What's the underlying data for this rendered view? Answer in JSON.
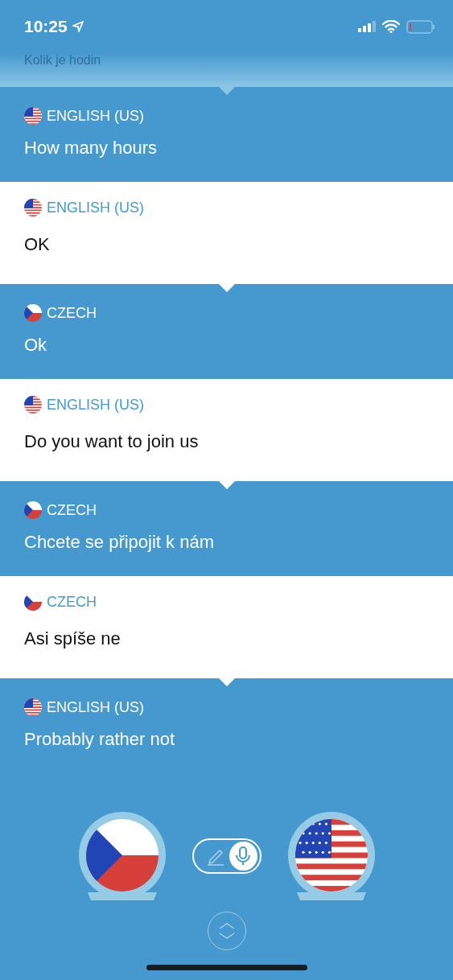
{
  "status_bar": {
    "time": "10:25"
  },
  "faded_message": {
    "text": "Kolik je hodin"
  },
  "messages": [
    {
      "kind": "translation",
      "flag": {
        "kind": "us"
      },
      "language": "ENGLISH (US)",
      "text": "How many hours"
    },
    {
      "kind": "source",
      "flag": {
        "kind": "us"
      },
      "language": "ENGLISH (US)",
      "text": "OK"
    },
    {
      "kind": "translation",
      "flag": {
        "kind": "cz"
      },
      "language": "CZECH",
      "text": "Ok"
    },
    {
      "kind": "source",
      "flag": {
        "kind": "us"
      },
      "language": "ENGLISH (US)",
      "text": "Do you want to join us"
    },
    {
      "kind": "translation",
      "flag": {
        "kind": "cz"
      },
      "language": "CZECH",
      "text": "Chcete se připojit k nám"
    },
    {
      "kind": "source",
      "flag": {
        "kind": "cz"
      },
      "language": "CZECH",
      "text": "Asi spíše ne"
    },
    {
      "kind": "translation",
      "flag": {
        "kind": "us"
      },
      "language": "ENGLISH (US)",
      "text": "Probably rather not"
    }
  ],
  "controls": {
    "left_flag": {
      "kind": "cz"
    },
    "right_flag": {
      "kind": "us"
    },
    "modes": [
      {
        "kind": "text",
        "selected": false
      },
      {
        "kind": "voice",
        "selected": true
      }
    ]
  }
}
